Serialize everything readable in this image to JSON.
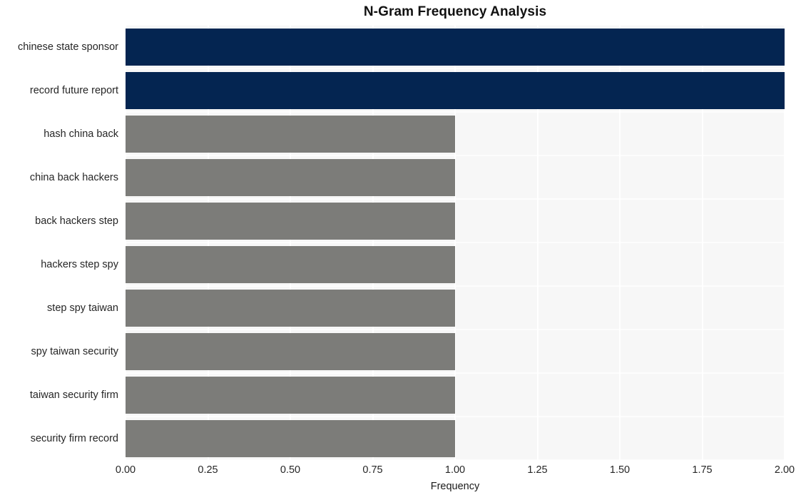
{
  "chart_data": {
    "type": "bar",
    "orientation": "horizontal",
    "title": "N-Gram Frequency Analysis",
    "xlabel": "Frequency",
    "ylabel": "",
    "categories": [
      "chinese state sponsor",
      "record future report",
      "hash china back",
      "china back hackers",
      "back hackers step",
      "hackers step spy",
      "step spy taiwan",
      "spy taiwan security",
      "taiwan security firm",
      "security firm record"
    ],
    "values": [
      2,
      2,
      1,
      1,
      1,
      1,
      1,
      1,
      1,
      1
    ],
    "bar_colors": [
      "#042551",
      "#042551",
      "#7c7c79",
      "#7c7c79",
      "#7c7c79",
      "#7c7c79",
      "#7c7c79",
      "#7c7c79",
      "#7c7c79",
      "#7c7c79"
    ],
    "xlim": [
      0,
      2.0
    ],
    "xticks": [
      0,
      0.25,
      0.5,
      0.75,
      1.0,
      1.25,
      1.5,
      1.75,
      2.0
    ],
    "xtick_labels": [
      "0.00",
      "0.25",
      "0.50",
      "0.75",
      "1.00",
      "1.25",
      "1.50",
      "1.75",
      "2.00"
    ],
    "grid": true,
    "legend": null,
    "plot_background": "#f7f7f7",
    "figure_background": "#ffffff",
    "gridline_color": "#ffffff",
    "highlight_color": "#042551",
    "default_color": "#7c7c79"
  }
}
